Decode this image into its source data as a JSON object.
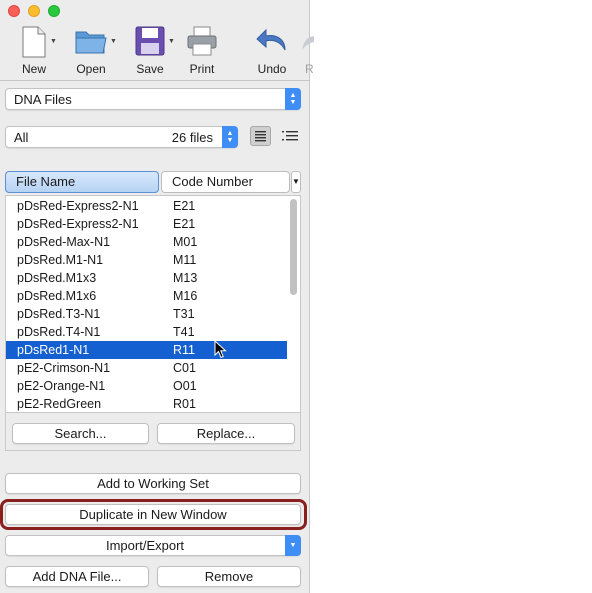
{
  "toolbar": {
    "new_label": "New",
    "open_label": "Open",
    "save_label": "Save",
    "print_label": "Print",
    "undo_label": "Undo",
    "redo_label": "R"
  },
  "collection": {
    "selected": "DNA Files"
  },
  "filter": {
    "selected": "All",
    "count": "26 files"
  },
  "columns": {
    "col1": "File Name",
    "col2": "Code Number"
  },
  "files": [
    {
      "name": "pDsRed-Express2-N1",
      "code": "E21"
    },
    {
      "name": "pDsRed-Express2-N1",
      "code": "E21"
    },
    {
      "name": "pDsRed-Max-N1",
      "code": "M01"
    },
    {
      "name": "pDsRed.M1-N1",
      "code": "M11"
    },
    {
      "name": "pDsRed.M1x3",
      "code": "M13"
    },
    {
      "name": "pDsRed.M1x6",
      "code": "M16"
    },
    {
      "name": "pDsRed.T3-N1",
      "code": "T31"
    },
    {
      "name": "pDsRed.T4-N1",
      "code": "T41"
    },
    {
      "name": "pDsRed1-N1",
      "code": "R11"
    },
    {
      "name": "pE2-Crimson-N1",
      "code": "C01"
    },
    {
      "name": "pE2-Orange-N1",
      "code": "O01"
    },
    {
      "name": "pE2-RedGreen",
      "code": "R01"
    }
  ],
  "selected_row": 8,
  "buttons": {
    "search": "Search...",
    "replace": "Replace...",
    "add_working_set": "Add to Working Set",
    "duplicate": "Duplicate in New Window",
    "import_export": "Import/Export",
    "add_dna": "Add DNA File...",
    "remove": "Remove"
  },
  "colors": {
    "accent": "#3f8ef5",
    "selection": "#1460d0",
    "highlight": "#8a1f1f"
  }
}
